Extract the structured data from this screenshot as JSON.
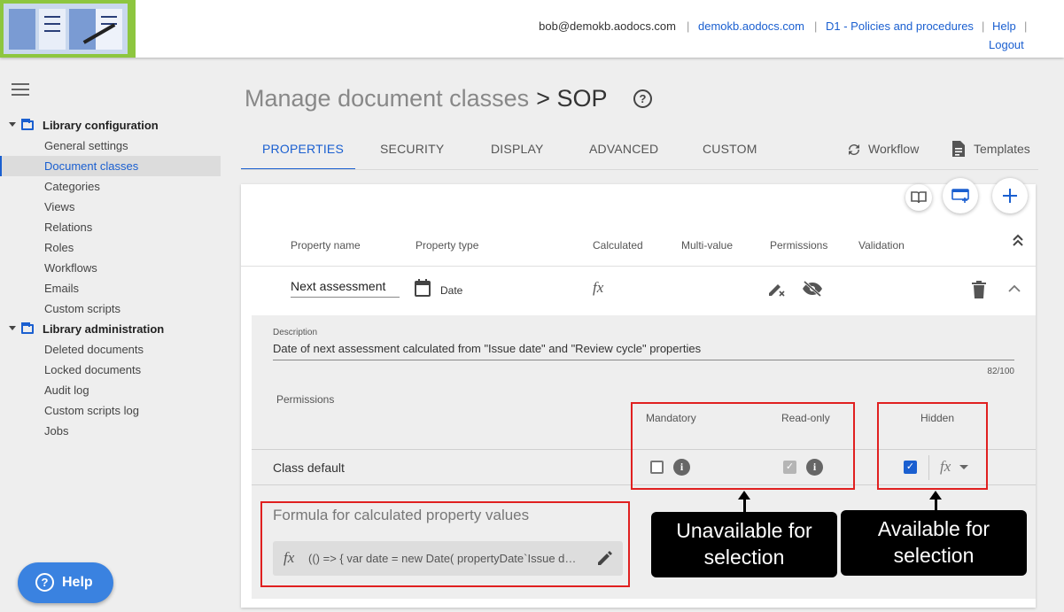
{
  "header": {
    "user_email": "bob@demokb.aodocs.com",
    "domain_link": "demokb.aodocs.com",
    "library_link": "D1 - Policies and procedures",
    "help_link": "Help",
    "logout_link": "Logout",
    "separator": "|"
  },
  "sidebar": {
    "groups": [
      {
        "label": "Library configuration",
        "items": [
          "General settings",
          "Document classes",
          "Categories",
          "Views",
          "Relations",
          "Roles",
          "Workflows",
          "Emails",
          "Custom scripts"
        ]
      },
      {
        "label": "Library administration",
        "items": [
          "Deleted documents",
          "Locked documents",
          "Audit log",
          "Custom scripts log",
          "Jobs"
        ]
      }
    ],
    "active_item": "Document classes",
    "help_button": "Help"
  },
  "main": {
    "title": "Manage document classes",
    "class_crumb": "> SOP",
    "help_glyph": "?",
    "tabs": [
      "PROPERTIES",
      "SECURITY",
      "DISPLAY",
      "ADVANCED",
      "CUSTOM"
    ],
    "workflow_label": "Workflow",
    "templates_label": "Templates"
  },
  "table": {
    "columns": [
      "Property name",
      "Property type",
      "Calculated",
      "Multi-value",
      "Permissions",
      "Validation"
    ],
    "property_name": "Next assessment",
    "property_type": "Date",
    "calculated_glyph": "fx"
  },
  "detail": {
    "description_label": "Description",
    "description": "Date of next assessment calculated from \"Issue date\" and \"Review cycle\" properties",
    "counter": "82/100",
    "permissions_label": "Permissions",
    "perm_columns": [
      "Mandatory",
      "Read-only",
      "Hidden"
    ],
    "row_label": "Class default",
    "mandatory_checked": false,
    "readonly_checked": true,
    "readonly_disabled": true,
    "hidden_checked": true,
    "info_glyph": "i",
    "formula_title": "Formula for calculated property values",
    "formula_glyph": "fx",
    "formula_code": "(() => { var date = new Date( propertyDate`Issue date` ); ..."
  },
  "annotations": {
    "unavailable": "Unavailable for selection",
    "available": "Available for selection"
  },
  "colors": {
    "accent": "#1a5fd0",
    "logo_bg": "#8dc63f",
    "annotation_red": "#e02020",
    "help_button": "#3a82e0"
  }
}
